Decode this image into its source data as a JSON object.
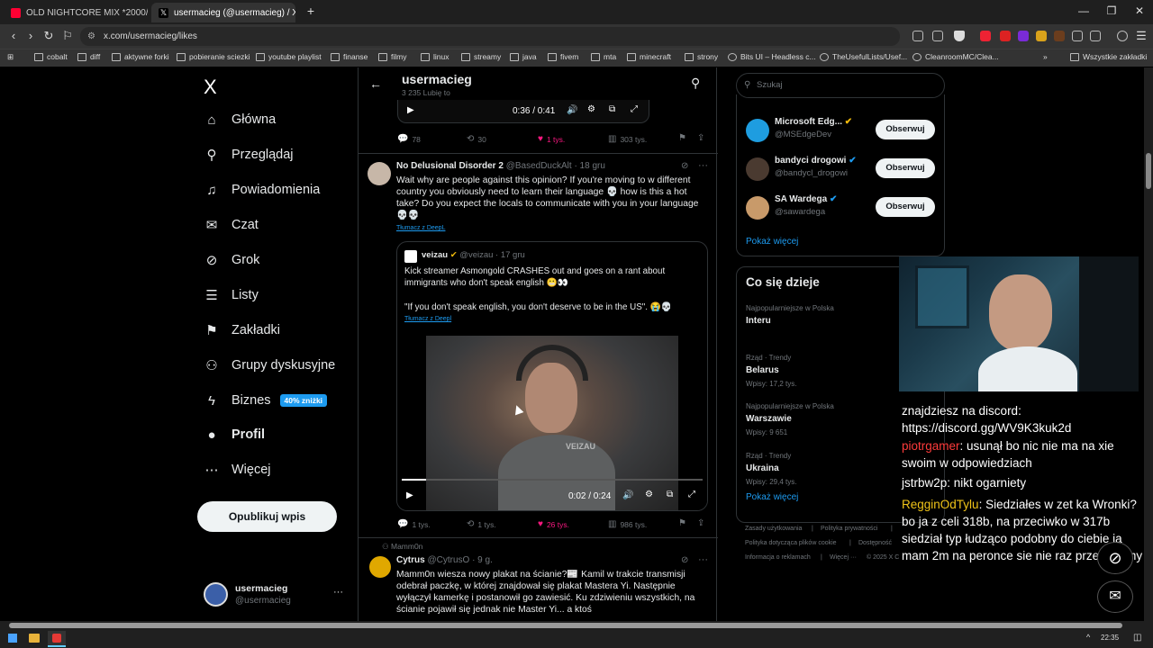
{
  "tabs": [
    {
      "title": "OLD NIGHTCORE MIX *2000/2010s*",
      "active": false,
      "favicon_color": "#ff0033"
    },
    {
      "title": "usermacieg (@usermacieg) / X",
      "active": true,
      "favicon_color": "#000000"
    }
  ],
  "new_tab": "+",
  "window_controls": {
    "minimize": "—",
    "restore": "❐",
    "close": "✕"
  },
  "address": {
    "url": "x.com/usermacieg/likes"
  },
  "bookmarks": [
    "cobalt",
    "diff",
    "aktywne forki",
    "pobieranie sciezki",
    "youtube playlist",
    "finanse",
    "filmy",
    "linux",
    "streamy",
    "java",
    "fivem",
    "mta",
    "minecraft",
    "strony",
    "Bits UI – Headless c...",
    "TheUsefulLists/Usef...",
    "CleanroomMC/Clea...",
    "»",
    "Wszystkie zakładki"
  ],
  "sidebar": {
    "logo": "X",
    "items": [
      {
        "label": "Główna",
        "icon": "home-icon",
        "glyph": "⌂"
      },
      {
        "label": "Przeglądaj",
        "icon": "search-icon",
        "glyph": "⚲"
      },
      {
        "label": "Powiadomienia",
        "icon": "bell-icon",
        "glyph": "♫"
      },
      {
        "label": "Czat",
        "icon": "mail-icon",
        "glyph": "✉"
      },
      {
        "label": "Grok",
        "icon": "grok-icon",
        "glyph": "⊘"
      },
      {
        "label": "Listy",
        "icon": "list-icon",
        "glyph": "☰"
      },
      {
        "label": "Zakładki",
        "icon": "bookmark-icon",
        "glyph": "⚑"
      },
      {
        "label": "Grupy dyskusyjne",
        "icon": "community-icon",
        "glyph": "⚇"
      },
      {
        "label": "Biznes",
        "icon": "lightning-icon",
        "glyph": "ϟ",
        "badge": "40% zniżki"
      },
      {
        "label": "Profil",
        "icon": "profile-icon",
        "glyph": "●"
      },
      {
        "label": "Więcej",
        "icon": "more-icon",
        "glyph": "⋯"
      }
    ],
    "post_button": "Opublikuj wpis",
    "account": {
      "name": "usermacieg",
      "handle": "@usermacieg",
      "more": "···"
    }
  },
  "header": {
    "name": "usermacieg",
    "subtitle": "3 235 Lubię to",
    "back": "←",
    "search": "⚲"
  },
  "top_tweet": {
    "player_time": "0:36 / 0:41",
    "actions": {
      "reply": "78",
      "retweet": "30",
      "like": "1 tys.",
      "views": "303 tys."
    }
  },
  "tweet1": {
    "name": "No Delusional Disorder 2",
    "handle": "@BasedDuckAlt",
    "date": "· 18 gru",
    "text": "Wait why are people against this opinion? If you're moving to w different country you obviously need to learn their language 💀 how is this a hot take? Do you expect the locals to communicate with you in your language 💀💀",
    "translate": "Tłumacz z DeepL",
    "quote": {
      "name": "veizau",
      "handle": "@veizau",
      "date": "· 17 gru",
      "text1": "Kick streamer Asmongold CRASHES out and goes on a rant about immigrants who don't speak english 😬👀",
      "text2": "\"If you don't speak english, you don't deserve to be in the US\". 😭💀",
      "translate": "Tłumacz z Deepl",
      "watermark": "VEIZAU",
      "player_time": "0:02 / 0:24",
      "progress": 0.08
    },
    "actions": {
      "reply": "1 tys.",
      "retweet": "1 tys.",
      "like": "26 tys.",
      "views": "986 tys."
    }
  },
  "tweet2": {
    "context": "Mamm0n",
    "name": "Cytrus",
    "handle": "@CytrusO",
    "date": "· 9 g.",
    "text": "Mamm0n wiesza nowy plakat na ścianie?📰 Kamil w trakcie transmisji odebrał paczkę, w której znajdował się plakat Mastera Yi. Następnie wyłączył kamerkę i postanowił go zawiesić. Ku zdziwieniu wszystkich, na ścianie pojawił się jednak nie Master Yi... a ktoś"
  },
  "right": {
    "search_placeholder": "Szukaj",
    "who_to_follow": [
      {
        "name": "Microsoft Edg...",
        "handle": "@MSEdgeDev",
        "button": "Obserwuj",
        "color": "#1e9de0"
      },
      {
        "name": "bandyci drogowi",
        "handle": "@bandycl_drogowi",
        "button": "Obserwuj",
        "color": "#4a3a30"
      },
      {
        "name": "SA Wardega",
        "handle": "@sawardega",
        "button": "Obserwuj",
        "color": "#c89a6a"
      }
    ],
    "show_more": "Pokaż więcej",
    "trends_title": "Co się dzieje",
    "trends": [
      {
        "category": "Najpopularniejsze w Polska",
        "name": "Interu",
        "count": ""
      },
      {
        "category": "Rząd · Trendy",
        "name": "Belarus",
        "count": "Wpisy: 17,2 tys."
      },
      {
        "category": "Najpopularniejsze w Polska",
        "name": "Warszawie",
        "count": "Wpisy: 9 651"
      },
      {
        "category": "Rząd · Trendy",
        "name": "Ukraina",
        "count": "Wpisy: 29,4 tys."
      }
    ],
    "trends_more": "Pokaż więcej",
    "footer": [
      "Zasady użytkowania",
      "|",
      "Polityka prywatności",
      "|",
      "Polityka dotycząca plików cookie",
      "|",
      "Dostępność",
      "Informacja o reklamach",
      "|",
      "Więcej ···",
      "© 2025 X C"
    ]
  },
  "chat": {
    "lines": [
      {
        "user": "",
        "text": "znajdziesz na discord: https://discord.gg/WV9K3kuk2d",
        "color": "#ffffff"
      },
      {
        "user": "piotrgamer",
        "text": ": usunął bo nic nie ma na xie swoim w odpowiedziach",
        "color": "#ff3b3b"
      },
      {
        "user": "jstrbw2p",
        "text": ": nikt ogarniety",
        "color": "#ffffff"
      },
      {
        "user": "RegginOdTylu",
        "text": ": Siedziałes w zet ka Wronki? bo ja z celi 318b, na przeciwko w 317b siedział typ łudząco podobny do ciebie ja mam 2m na peronce sie nie raz przecięliśmy",
        "color": "#f0c419"
      }
    ]
  },
  "taskbar": {
    "time": "22:35"
  }
}
